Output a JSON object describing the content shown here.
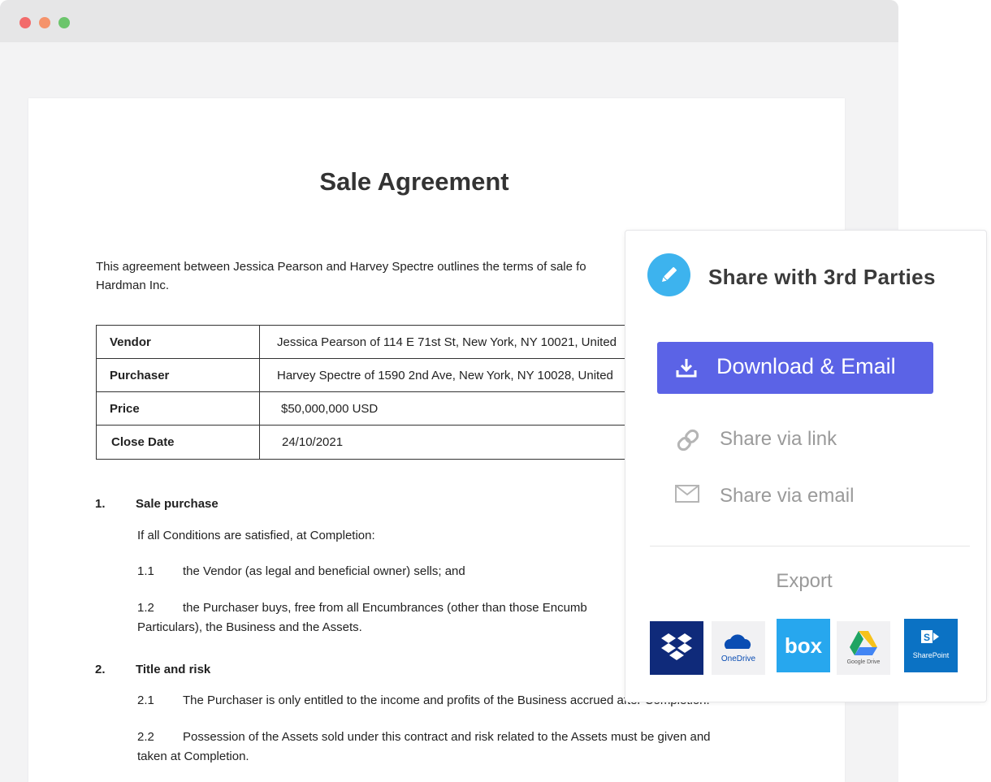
{
  "document": {
    "title": "Sale Agreement",
    "intro_line1": "This agreement between Jessica Pearson and Harvey Spectre outlines the terms of sale fo",
    "intro_line2": "Hardman Inc.",
    "table": [
      {
        "label": "Vendor",
        "value": "Jessica Pearson of 114 E 71st St, New York, NY 10021, United"
      },
      {
        "label": "Purchaser",
        "value": "Harvey Spectre of 1590 2nd Ave, New York, NY 10028, United"
      },
      {
        "label": "Price",
        "value": "$50,000,000 USD"
      },
      {
        "label": "Close Date",
        "value": "24/10/2021"
      }
    ],
    "sections": [
      {
        "number": "1.",
        "heading": "Sale purchase",
        "lead": "If all Conditions are satisfied, at Completion:",
        "clauses": [
          {
            "number": "1.1",
            "text": "the Vendor (as legal and beneficial owner) sells; and"
          },
          {
            "number": "1.2",
            "text": "the Purchaser buys, free from all Encumbrances (other than those Encumb",
            "text2": "Particulars), the Business and the Assets."
          }
        ]
      },
      {
        "number": "2.",
        "heading": "Title and risk",
        "clauses": [
          {
            "number": "2.1",
            "text": "The Purchaser is only entitled to the income and profits of the Business accrued after Completion."
          },
          {
            "number": "2.2",
            "text": "Possession of the Assets sold under this contract and risk related to the Assets must be given and",
            "text2": "taken at Completion."
          }
        ]
      }
    ]
  },
  "share_panel": {
    "title": "Share with 3rd Parties",
    "download_button": "Download & Email",
    "share_link": "Share via link",
    "share_email": "Share via email",
    "export_label": "Export",
    "export_services": [
      {
        "name": "Dropbox",
        "label": "",
        "color": "#0f2a7a"
      },
      {
        "name": "OneDrive",
        "label": "OneDrive",
        "color": "#f1f1f3"
      },
      {
        "name": "Box",
        "label": "box",
        "color": "#27a7ee"
      },
      {
        "name": "Google Drive",
        "label": "Google Drive",
        "color": "#f1f1f3"
      },
      {
        "name": "SharePoint",
        "label": "SharePoint",
        "color": "#0b72c4"
      }
    ],
    "colors": {
      "accent": "#5b63e6",
      "pen_circle": "#3db3ee",
      "muted_text": "#9a9a9a"
    }
  }
}
